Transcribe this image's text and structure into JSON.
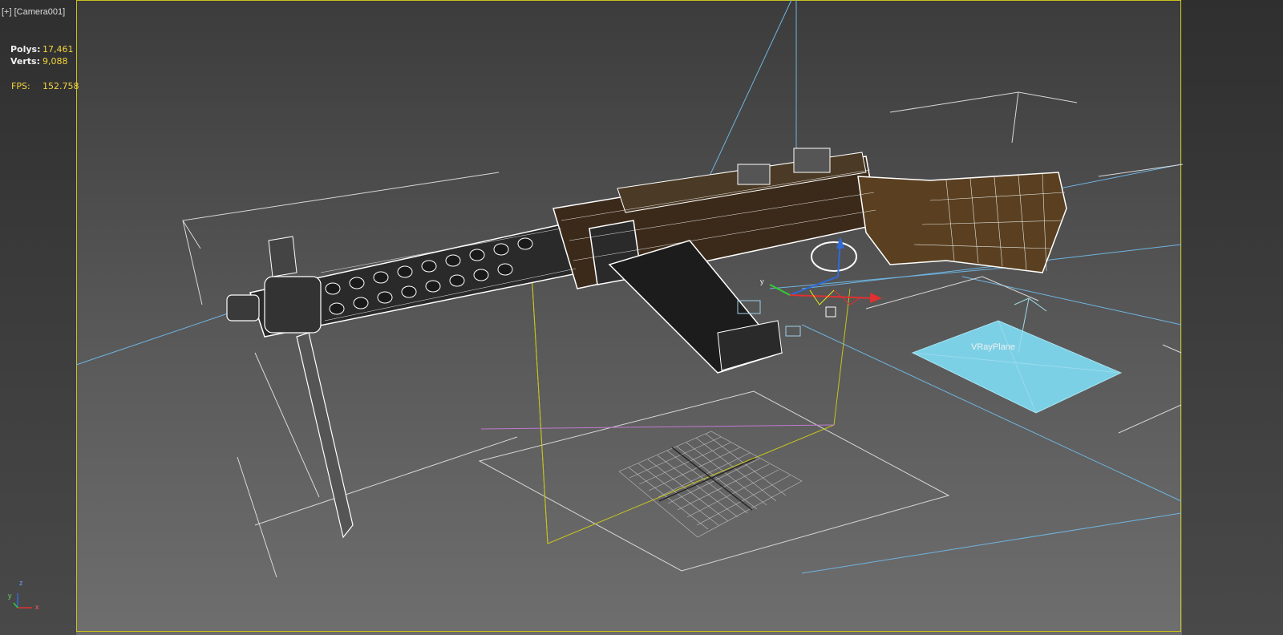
{
  "viewport": {
    "menu_plus": "[+]",
    "camera_name": "[Camera001]"
  },
  "stats": {
    "polys_label": "Polys:",
    "polys_value": "17,461",
    "verts_label": "Verts:",
    "verts_value": "9,088",
    "fps_label": "FPS:",
    "fps_value": "152.758"
  },
  "scene": {
    "object_label": "VRayPlane",
    "gizmo_y": "y",
    "axis_x": "x",
    "axis_y": "y",
    "axis_z": "z"
  },
  "colors": {
    "safe_frame": "#c9c21b",
    "camera_wire": "#6fb4e0",
    "vray_plane": "#7cd0e6",
    "wire": "#ffffff",
    "stats_value": "#f2d43c"
  },
  "icons": [
    "view-cube-axis-icon",
    "transform-gizmo-icon",
    "grid-icon"
  ]
}
